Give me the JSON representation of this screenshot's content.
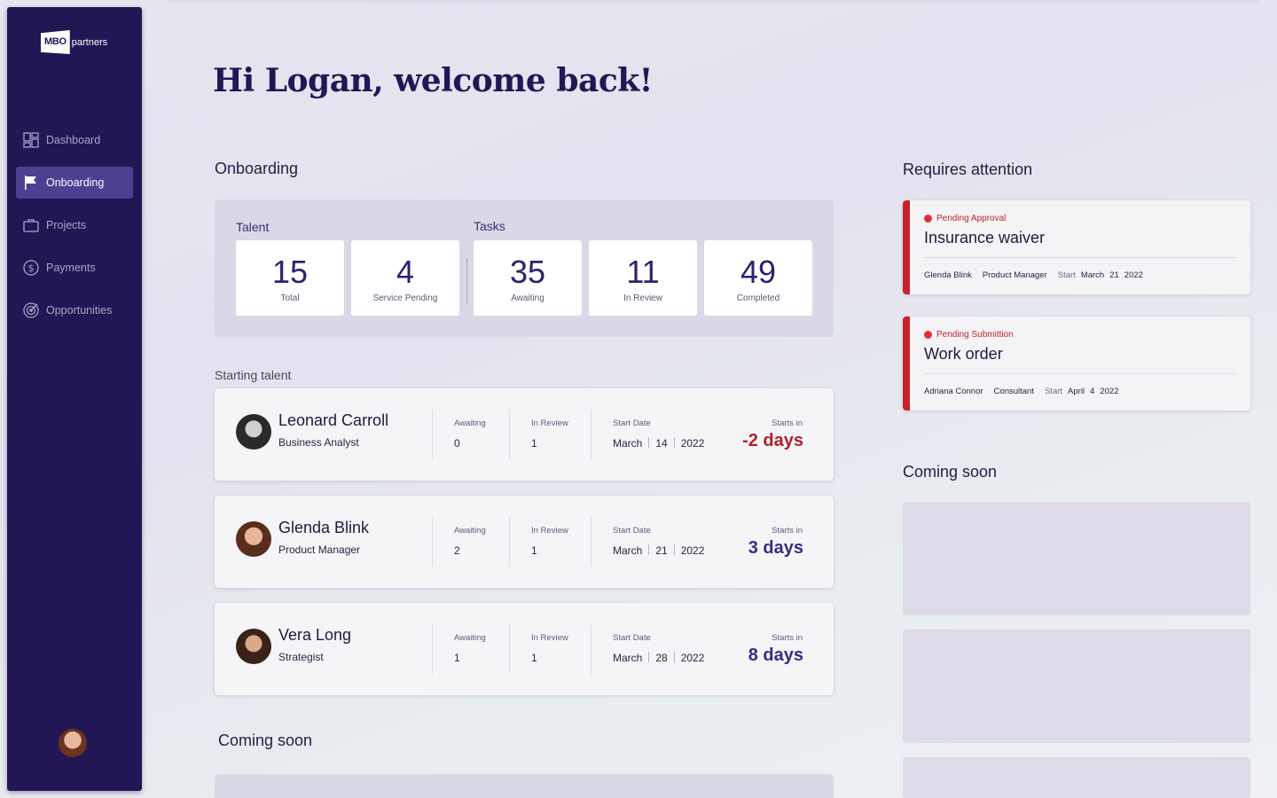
{
  "brand": {
    "logo_mark": "MBO",
    "logo_text": "partners"
  },
  "sidebar": {
    "items": [
      {
        "label": "Dashboard",
        "icon": "dashboard-icon",
        "active": false
      },
      {
        "label": "Onboarding",
        "icon": "flag-icon",
        "active": true
      },
      {
        "label": "Projects",
        "icon": "briefcase-icon",
        "active": false
      },
      {
        "label": "Payments",
        "icon": "dollar-circle-icon",
        "active": false
      },
      {
        "label": "Opportunities",
        "icon": "target-icon",
        "active": false
      }
    ]
  },
  "header": {
    "welcome": "Hi Logan, welcome back!"
  },
  "onboarding": {
    "title": "Onboarding",
    "talent_label": "Talent",
    "tasks_label": "Tasks",
    "stats": [
      {
        "value": "15",
        "label": "Total"
      },
      {
        "value": "4",
        "label": "Service Pending"
      },
      {
        "value": "35",
        "label": "Awaiting"
      },
      {
        "value": "11",
        "label": "In Review"
      },
      {
        "value": "49",
        "label": "Completed"
      }
    ]
  },
  "starting_talent": {
    "title": "Starting talent",
    "labels": {
      "awaiting": "Awaiting",
      "in_review": "In Review",
      "start_date": "Start Date",
      "starts_in": "Starts in"
    },
    "rows": [
      {
        "name": "Leonard Carroll",
        "role": "Business Analyst",
        "awaiting": "0",
        "in_review": "1",
        "month": "March",
        "day": "14",
        "year": "2022",
        "starts_in": "-2 days"
      },
      {
        "name": "Glenda Blink",
        "role": "Product Manager",
        "awaiting": "2",
        "in_review": "1",
        "month": "March",
        "day": "21",
        "year": "2022",
        "starts_in": "3 days"
      },
      {
        "name": "Vera Long",
        "role": "Strategist",
        "awaiting": "1",
        "in_review": "1",
        "month": "March",
        "day": "28",
        "year": "2022",
        "starts_in": "8 days"
      }
    ]
  },
  "coming_soon_main": {
    "title": "Coming soon"
  },
  "requires_attention": {
    "title": "Requires attention",
    "start_label": "Start",
    "cards": [
      {
        "status": "Pending Approval",
        "title": "Insurance waiver",
        "person": "Glenda Blink",
        "role": "Product Manager",
        "month": "March",
        "day": "21",
        "year": "2022"
      },
      {
        "status": "Pending Submittion",
        "title": "Work order",
        "person": "Adriana Connor",
        "role": "Consultant",
        "month": "April",
        "day": "4",
        "year": "2022"
      }
    ]
  },
  "coming_soon_right": {
    "title": "Coming soon"
  },
  "colors": {
    "sidebar": "#221754",
    "accent": "#2c2270",
    "alert": "#c8222c"
  }
}
